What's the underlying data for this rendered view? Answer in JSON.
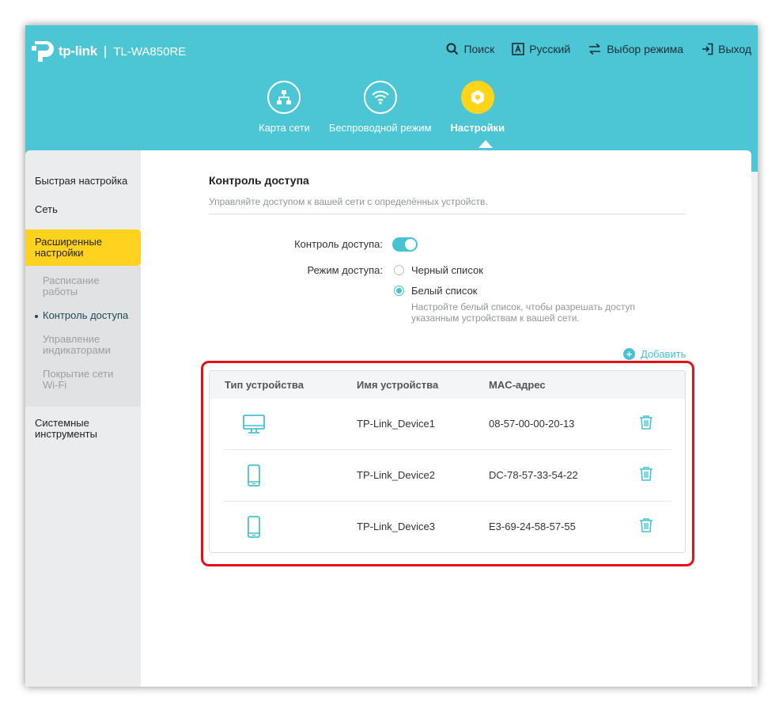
{
  "header": {
    "brand": "tp-link",
    "separator": "|",
    "model": "TL-WA850RE",
    "links": [
      {
        "label": "Поиск",
        "icon": "search-icon"
      },
      {
        "label": "Русский",
        "icon": "language-icon"
      },
      {
        "label": "Выбор режима",
        "icon": "mode-switch-icon"
      },
      {
        "label": "Выход",
        "icon": "logout-icon"
      }
    ],
    "tabs": [
      {
        "label": "Карта сети",
        "icon": "network-map-icon",
        "active": false
      },
      {
        "label": "Беспроводной режим",
        "icon": "wifi-icon",
        "active": false
      },
      {
        "label": "Настройки",
        "icon": "settings-gear-icon",
        "active": true
      }
    ]
  },
  "sidebar": {
    "items": [
      {
        "label": "Быстрая настройка"
      },
      {
        "label": "Сеть"
      },
      {
        "label": "Расширенные настройки",
        "active": true
      },
      {
        "label": "Системные инструменты"
      }
    ],
    "subitems": [
      {
        "label": "Расписание работы"
      },
      {
        "label": "Контроль доступа",
        "current": true
      },
      {
        "label": "Управление индикаторами"
      },
      {
        "label": "Покрытие сети Wi-Fi"
      }
    ]
  },
  "main": {
    "title": "Контроль доступа",
    "subtitle": "Управляйте доступом к вашей сети с определённых устройств.",
    "access_control_label": "Контроль доступа:",
    "access_control_enabled": true,
    "access_mode_label": "Режим доступа:",
    "modes": [
      {
        "label": "Черный список",
        "checked": false
      },
      {
        "label": "Белый список",
        "checked": true
      }
    ],
    "hint": "Настройте белый список, чтобы разрешать доступ указанным устройствам к вашей сети.",
    "add_label": "Добавить",
    "table": {
      "columns": [
        "Тип устройства",
        "Имя устройства",
        "MAC-адрес"
      ],
      "rows": [
        {
          "type": "desktop-icon",
          "name": "TP-Link_Device1",
          "mac": "08-57-00-00-20-13"
        },
        {
          "type": "smartphone-icon",
          "name": "TP-Link_Device2",
          "mac": "DC-78-57-33-54-22"
        },
        {
          "type": "smartphone-icon",
          "name": "TP-Link_Device3",
          "mac": "E3-69-24-58-57-55"
        }
      ]
    }
  },
  "colors": {
    "header_bg": "#4cc6d5",
    "accent": "#45c3d2",
    "active_yellow": "#ffd21f",
    "highlight_red": "#e3101a"
  }
}
